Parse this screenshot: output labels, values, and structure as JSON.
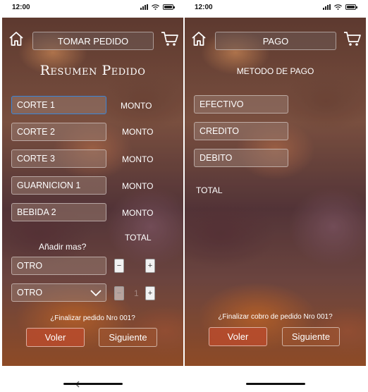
{
  "left": {
    "time": "12:00",
    "title": "TOMAR PEDIDO",
    "heading": "Resumen Pedido",
    "items": [
      {
        "label": "CORTE 1",
        "amount": "MONTO"
      },
      {
        "label": "CORTE 2",
        "amount": "MONTO"
      },
      {
        "label": "CORTE 3",
        "amount": "MONTO"
      },
      {
        "label": "GUARNICION 1",
        "amount": "MONTO"
      },
      {
        "label": "BEBIDA 2",
        "amount": "MONTO"
      }
    ],
    "total_label": "TOTAL",
    "add_more": "Añadir mas?",
    "extra1": {
      "label": "OTRO",
      "minus": "−",
      "plus": "+"
    },
    "extra2": {
      "label": "OTRO",
      "minus": "−",
      "value": "1",
      "plus": "+"
    },
    "question": "¿Finalizar pedido Nro 001?",
    "back_label": "Voler",
    "next_label": "Siguiente"
  },
  "right": {
    "time": "12:00",
    "title": "PAGO",
    "heading": "METODO DE PAGO",
    "methods": [
      "EFECTIVO",
      "CREDITO",
      "DEBITO"
    ],
    "total_label": "TOTAL",
    "question": "¿Finalizar cobro de pedido Nro 001?",
    "back_label": "Voler",
    "next_label": "Siguiente"
  },
  "icons": {
    "home": "home-icon",
    "cart": "cart-icon",
    "chevron": "chevron-down-icon",
    "back": "back-arrow-icon"
  },
  "colors": {
    "focus_border": "#3a86d8",
    "primary_button": "#b94b2d"
  }
}
